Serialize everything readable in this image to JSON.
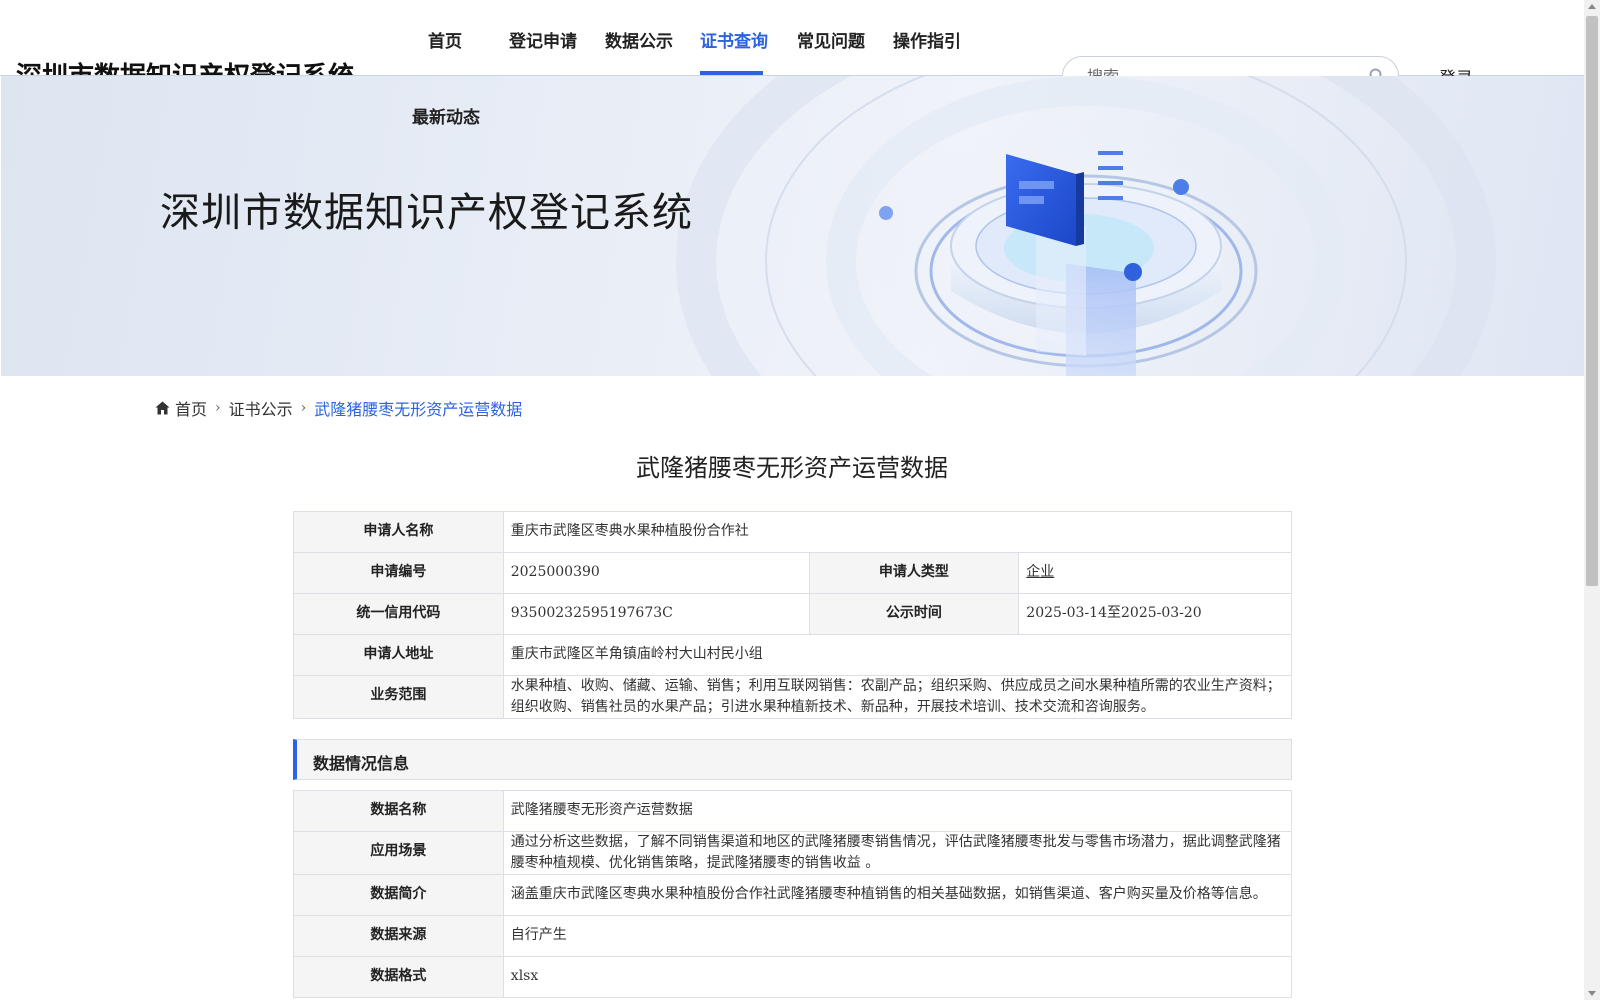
{
  "header": {
    "site_title": "深圳市数据知识产权登记系统",
    "nav": [
      {
        "label": "首页"
      },
      {
        "label": "登记申请"
      },
      {
        "label": "数据公示"
      },
      {
        "label": "证书查询"
      },
      {
        "label": "常见问题"
      },
      {
        "label": "操作指引"
      },
      {
        "label": "最新动态"
      }
    ],
    "active_nav": "证书查询",
    "search_placeholder": "搜索",
    "login_label": "登录"
  },
  "banner": {
    "title": "深圳市数据知识产权登记系统"
  },
  "breadcrumb": {
    "home": "首页",
    "level1": "证书公示",
    "current": "武隆猪腰枣无形资产运营数据"
  },
  "page_title": "武隆猪腰枣无形资产运营数据",
  "applicant": {
    "name_label": "申请人名称",
    "name_value": "重庆市武隆区枣典水果种植股份合作社",
    "code_label": "申请编号",
    "code_value": "2025000390",
    "type_label": "申请人类型",
    "type_value": "企业",
    "credit_label": "统一信用代码",
    "credit_value": "93500232595197673C",
    "publicity_label": "公示时间",
    "publicity_value": "2025-03-14至2025-03-20",
    "address_label": "申请人地址",
    "address_value": "重庆市武隆区羊角镇庙岭村大山村民小组",
    "scope_label": "业务范围",
    "scope_value": "水果种植、收购、储藏、运输、销售；利用互联网销售：农副产品；组织采购、供应成员之间水果种植所需的农业生产资料；组织收购、销售社员的水果产品；引进水果种植新技术、新品种，开展技术培训、技术交流和咨询服务。"
  },
  "data_section": {
    "title": "数据情况信息",
    "rows": [
      {
        "label": "数据名称",
        "value": "武隆猪腰枣无形资产运营数据"
      },
      {
        "label": "应用场景",
        "value": "通过分析这些数据，了解不同销售渠道和地区的武隆猪腰枣销售情况，评估武隆猪腰枣批发与零售市场潜力，据此调整武隆猪腰枣种植规模、优化销售策略，提武隆猪腰枣的销售收益 。"
      },
      {
        "label": "数据简介",
        "value": "涵盖重庆市武隆区枣典水果种植股份合作社武隆猪腰枣种植销售的相关基础数据，如销售渠道、客户购买量及价格等信息。"
      },
      {
        "label": "数据来源",
        "value": "自行产生"
      },
      {
        "label": "数据格式",
        "value": "xlsx"
      }
    ]
  },
  "colors": {
    "accent": "#2b63e0",
    "label_bg": "#f5f5f5",
    "border": "#dcdfe6"
  }
}
